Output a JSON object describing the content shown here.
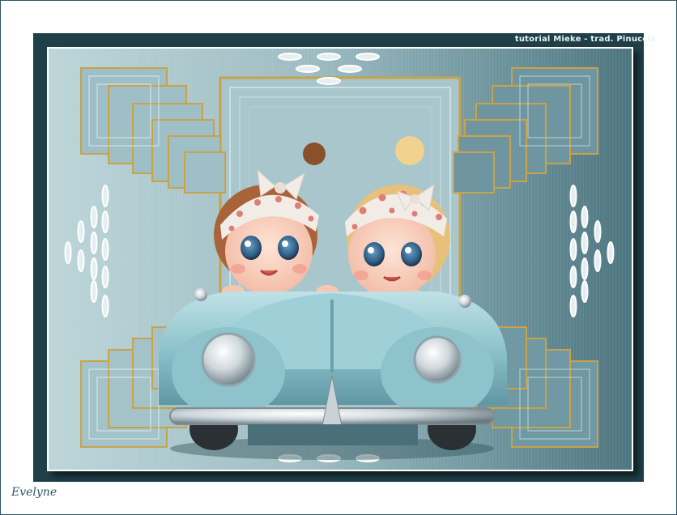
{
  "image": {
    "watermark_text": "tutorial Mieke - trad. Pinuccia",
    "signature_text": "Evelyne",
    "subject": "two cartoon toddler girls with polka-dot bandanas riding in a light blue vintage toy car",
    "colors": {
      "frame_dark": "#204049",
      "background_light": "#b7d1d6",
      "background_dark": "#4c737d",
      "gold_accent": "#c9a24a",
      "car_blue": "#8fc3cc",
      "chrome": "#d9e2e6",
      "bandana": "#f2ece6",
      "polka_dot": "#e07d76"
    }
  }
}
